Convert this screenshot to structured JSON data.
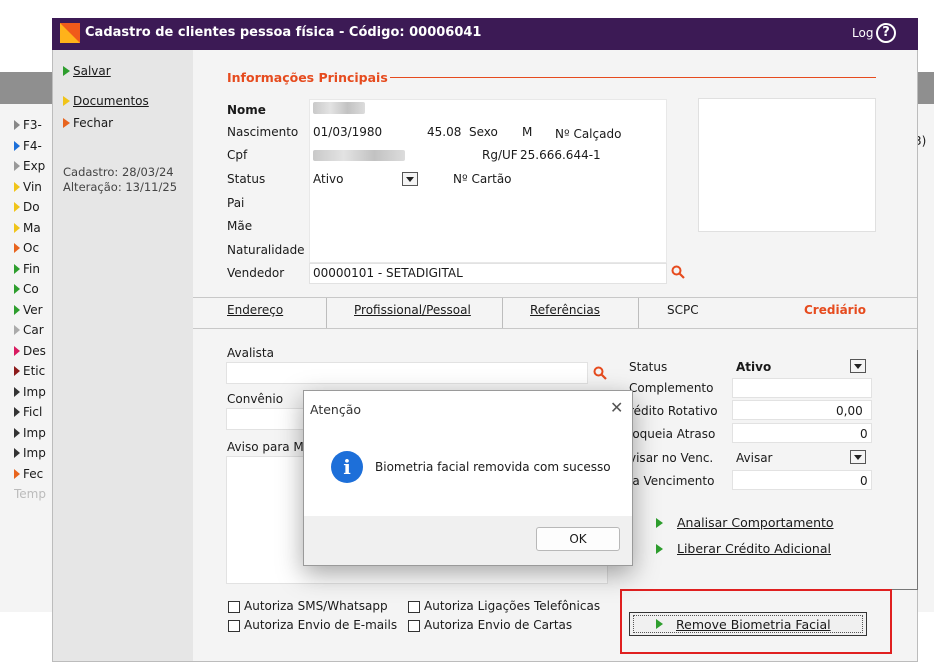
{
  "background_window": {
    "items": [
      "F3-",
      "F4-",
      "Exp",
      "Vin",
      "Do",
      "Ma",
      "Oc",
      "Fin",
      "Co",
      "Ver",
      "Car",
      "Des",
      "Etic",
      "Imp",
      "Ficl",
      "Imp",
      "Imp",
      "Fec",
      "Temp"
    ],
    "right_fragment": "3)"
  },
  "window": {
    "title": "Cadastro de clientes pessoa física - Código: 00006041",
    "log_label": "Log",
    "help_symbol": "?"
  },
  "menu": {
    "items": [
      {
        "label": "Salvar",
        "color": "#2e9e2e"
      },
      {
        "label": "Documentos",
        "color": "#f0c419"
      },
      {
        "label": "Fechar",
        "color": "#e8641e"
      }
    ],
    "cadastro": "Cadastro: 28/03/24",
    "alteracao": "Alteração: 13/11/25"
  },
  "main_info": {
    "section_title": "Informações Principais",
    "nome_label": "Nome",
    "nascimento_label": "Nascimento",
    "nascimento_value": "01/03/1980",
    "idade_value": "45.08",
    "sexo_label": "Sexo",
    "sexo_value": "M",
    "calcado_label": "Nº Calçado",
    "cpf_label": "Cpf",
    "rg_label": "Rg/UF",
    "rg_value": "25.666.644-1",
    "status_label": "Status",
    "status_value": "Ativo",
    "cartao_label": "Nº Cartão",
    "pai_label": "Pai",
    "mae_label": "Mãe",
    "naturalidade_label": "Naturalidade",
    "vendedor_label": "Vendedor",
    "vendedor_value": "00000101 - SETADIGITAL"
  },
  "tabs": [
    {
      "label": "Endereço",
      "active": false
    },
    {
      "label": "Profissional/Pessoal",
      "active": false
    },
    {
      "label": "Referências",
      "active": false
    },
    {
      "label": "SCPC",
      "active": false
    },
    {
      "label": "Crediário",
      "active": true
    }
  ],
  "crediario": {
    "avalista_label": "Avalista",
    "convenio_label": "Convênio",
    "aviso_label": "Aviso para M",
    "status_label": "Status",
    "status_value": "Ativo",
    "complemento_label": "Complemento",
    "credito_rotativo_label": "rédito Rotativo",
    "credito_rotativo_value": "0,00",
    "bloqueia_atraso_label": "loqueia Atraso",
    "bloqueia_atraso_value": "0",
    "avisar_venc_label": "visar no Venc.",
    "avisar_venc_value": "Avisar",
    "dia_vencimento_label": "ia Vencimento",
    "dia_vencimento_value": "0",
    "analisar_label": "Analisar Comportamento",
    "liberar_label": "Liberar Crédito Adicional"
  },
  "checkboxes": [
    {
      "label": "Autoriza SMS/Whatsapp",
      "checked": false
    },
    {
      "label": "Autoriza Ligações Telefônicas",
      "checked": false
    },
    {
      "label": "Autoriza Envio de E-mails",
      "checked": false
    },
    {
      "label": "Autoriza Envio de Cartas",
      "checked": false
    }
  ],
  "remove_button_label": "Remove Biometria Facial",
  "dialog": {
    "title": "Atenção",
    "close_symbol": "✕",
    "icon_symbol": "i",
    "message": "Biometria facial removida com sucesso",
    "ok_label": "OK"
  },
  "colors": {
    "titlebar": "#3c1a55",
    "accent": "#e64b1e",
    "info_icon": "#1d6fd9",
    "highlight": "#e02020"
  }
}
